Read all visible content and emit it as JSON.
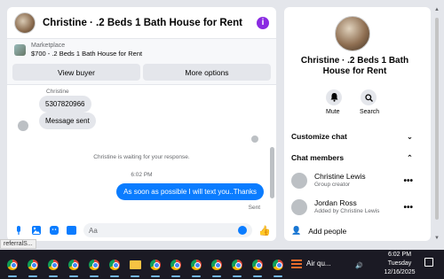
{
  "chat": {
    "title": "Christine · .2 Beds 1 Bath House for Rent",
    "info_icon": "info-icon",
    "marketplace_label": "Marketplace",
    "listing": "$700 - .2 Beds 1 Bath House for Rent",
    "view_buyer": "View buyer",
    "more_options": "More options"
  },
  "messages": {
    "sender_name": "Christine",
    "incoming": [
      "5307820966",
      "Message sent"
    ],
    "waiting_text": "Christine is waiting for your response.",
    "timestamp": "6:02 PM",
    "outgoing": "As soon as possible I will text you..Thanks",
    "sent_label": "Sent"
  },
  "composer": {
    "placeholder": "Aa",
    "icons": [
      "microphone-icon",
      "photo-icon",
      "sticker-icon",
      "gif-icon",
      "emoji-icon",
      "like-icon"
    ],
    "gif_label": "GIF"
  },
  "details": {
    "title": "Christine · .2 Beds 1 Bath House for Rent",
    "mute_label": "Mute",
    "search_label": "Search",
    "customize_chat": "Customize chat",
    "chat_members": "Chat members",
    "members": [
      {
        "name": "Christine Lewis",
        "role": "Group creator"
      },
      {
        "name": "Jordan Ross",
        "role": "Added by Christine Lewis"
      }
    ],
    "add_people": "Add people"
  },
  "browser": {
    "status_url": "referralS..."
  },
  "taskbar": {
    "weather": "Air qu...",
    "time": "6:02 PM",
    "day": "Tuesday",
    "date": "12/16/2025"
  },
  "colors": {
    "accent": "#0a7cff",
    "info": "#8a2be2",
    "taskbar": "#1b1a24"
  }
}
